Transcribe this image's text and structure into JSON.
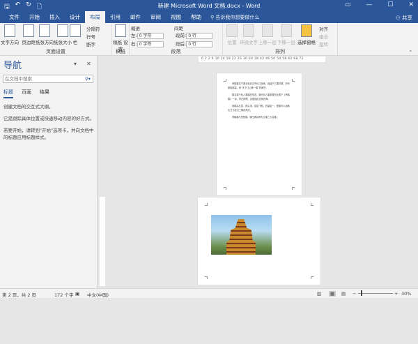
{
  "window": {
    "title": "新建 Microsoft Word 文档.docx - Word",
    "quick_access": [
      "save-icon",
      "undo-icon",
      "redo-icon",
      "print-preview-icon"
    ]
  },
  "tabs": [
    "文件",
    "开始",
    "插入",
    "设计",
    "布局",
    "引用",
    "邮件",
    "审阅",
    "视图",
    "帮助"
  ],
  "active_tab": "布局",
  "tell_me": "告诉我你想要做什么",
  "share": "共享",
  "ribbon": {
    "page_setup": {
      "label": "页面设置",
      "buttons": [
        "文字方向",
        "页边距",
        "纸张方向",
        "纸张大小",
        "栏"
      ],
      "small": [
        "分隔符",
        "行号",
        "断字"
      ]
    },
    "manuscript": {
      "label": "稿纸",
      "button": "稿纸\n设置"
    },
    "paragraph": {
      "label": "段落",
      "indent": "缩进",
      "spacing": "间距",
      "left": "左:",
      "right": "右:",
      "before": "段前:",
      "after": "段后:",
      "left_val": "0 字符",
      "right_val": "0 字符",
      "before_val": "0 行",
      "after_val": "0 行"
    },
    "arrange": {
      "label": "排列",
      "buttons": [
        "位置",
        "环绕文字",
        "上移一层",
        "下移一层",
        "选择窗格"
      ],
      "small": [
        "对齐",
        "组合",
        "旋转"
      ]
    }
  },
  "nav": {
    "title": "导航",
    "search_placeholder": "在文档中搜索",
    "tabs": [
      "标题",
      "页面",
      "结果"
    ],
    "paragraphs": [
      "创建文档的交互式大纲。",
      "它是跟踪具体位置或快速移动内容的好方式。",
      "若要开始，请转到\"开始\"选项卡，并向文档中的标题应用标题样式。"
    ]
  },
  "ruler": "6  2  2  6  10  14  18  22  26  30  34  38  42  46  50  54  58  62  68  72",
  "page1_text": [
    "黄鹤楼位于湖北省武汉市长江南岸，始建于三国时期，历代屡毁屡建，有“天下江山第一楼”的美誉。",
    "楼名源于仙人乘鹤的传说，唐代诗人崔颢曾在此题下《黄鹤楼》一诗，李白搁笔，此楼因此名扬四海。",
    "现楼高五层，攒尖顶，层层飞檐，四望如一，登楼可以远眺长江与武汉三镇的风光。",
    "黄鹤楼与岳阳楼、滕王阁并称为江南三大名楼。"
  ],
  "status": {
    "page": "第 2 页，共 2 页",
    "words": "172 个字",
    "language": "中文(中国)",
    "zoom": "30%"
  }
}
